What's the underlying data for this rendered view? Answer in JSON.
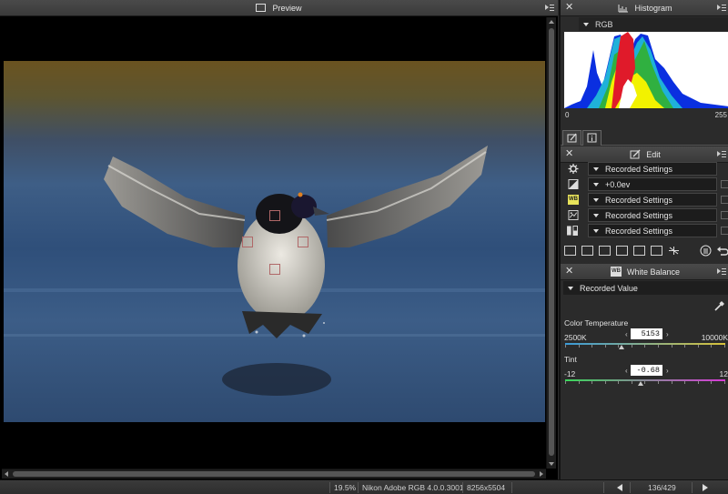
{
  "preview": {
    "title": "Preview",
    "photo_alt_subject": ""
  },
  "histogram": {
    "title": "Histogram",
    "channel": "RGB",
    "min_label": "0",
    "max_label": "255"
  },
  "edit": {
    "title": "Edit",
    "rows": [
      {
        "icon": "gear-icon",
        "value": "Recorded Settings"
      },
      {
        "icon": "exposure-icon",
        "value": "+0.0ev"
      },
      {
        "icon": "white-balance-icon",
        "icon_text": "WB",
        "value": "Recorded Settings"
      },
      {
        "icon": "picture-control-icon",
        "value": "Recorded Settings"
      },
      {
        "icon": "tone-icon",
        "value": "Recorded Settings"
      }
    ]
  },
  "white_balance": {
    "title": "White Balance",
    "icon_text": "WB",
    "mode": "Recorded Value",
    "color_temperature": {
      "label": "Color Temperature",
      "min": "2500K",
      "max": "10000K",
      "value": "5153",
      "numeric_value": 5153,
      "range": [
        2500,
        10000
      ]
    },
    "tint": {
      "label": "Tint",
      "min": "-12",
      "max": "12",
      "value": "-0.68",
      "numeric_value": -0.68,
      "range": [
        -12,
        12
      ]
    },
    "step_left": "‹",
    "step_right": "›"
  },
  "status": {
    "zoom": "19.5%",
    "color_profile": "Nikon Adobe RGB 4.0.0.3001",
    "dimensions": "8256x5504",
    "page_counter": "136/429"
  },
  "colors": {
    "wb_icon_bg": "#e8e35a",
    "focus_point": "#b06868",
    "temp_gradient_start": "#3a9ad8",
    "temp_gradient_end": "#d8c23a",
    "tint_gradient_start": "#3ad85a",
    "tint_gradient_end": "#d83ad8"
  }
}
